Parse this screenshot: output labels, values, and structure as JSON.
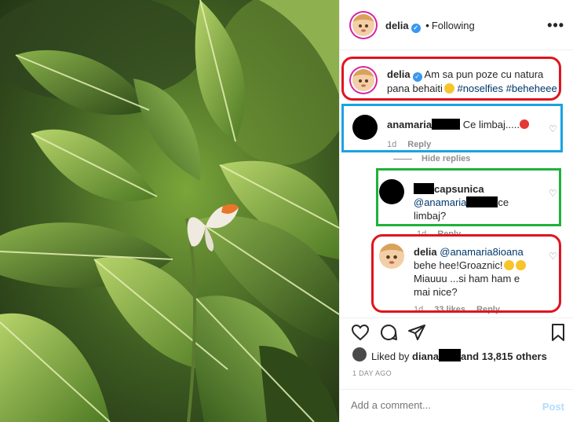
{
  "header": {
    "username": "delia",
    "separator": "•",
    "follow_status": "Following",
    "more": "•••"
  },
  "caption": {
    "username": "delia",
    "text": "Am sa pun poze cu natura pana behaiti",
    "hashtags": "#noselfies #beheheee"
  },
  "comments": [
    {
      "username": "anamaria",
      "text": "Ce limbaj.....",
      "time": "1d",
      "reply": "Reply"
    }
  ],
  "hide_replies": "Hide replies",
  "replies": [
    {
      "username_suffix": "capsunica",
      "mention": "@anamaria",
      "text_after": "ce",
      "text_line2": "limbaj?",
      "time": "1d",
      "reply": "Reply"
    },
    {
      "username": "delia",
      "mention": "@anamaria8ioana",
      "line1": "behe hee!Groaznic!",
      "line2": "Miauuu ...si ham ham e",
      "line3": "mai nice?",
      "time": "1d",
      "likes": "33 likes",
      "reply": "Reply"
    }
  ],
  "likes": {
    "prefix": "Liked by ",
    "user": "diana",
    "suffix": "and 13,815 others"
  },
  "time_ago": "1 DAY AGO",
  "add_comment": {
    "placeholder": "Add a comment...",
    "post_label": "Post"
  },
  "colors": {
    "annotation_red": "#e0141e",
    "annotation_blue": "#1aa3e0",
    "annotation_green": "#1fb23a",
    "verified_blue": "#3897f0",
    "link_blue": "#00376b"
  }
}
